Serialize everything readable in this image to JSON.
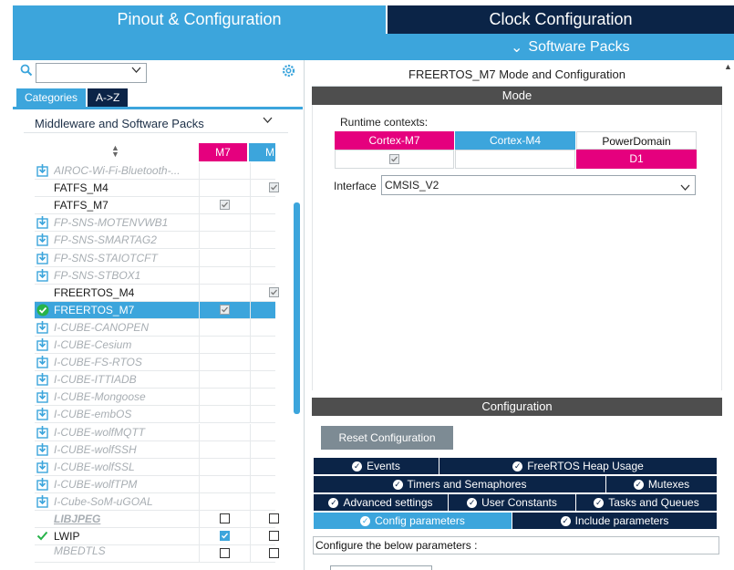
{
  "tabs": {
    "pinout": "Pinout & Configuration",
    "clock": "Clock Configuration"
  },
  "software_packs": "Software Packs",
  "left": {
    "categories_tab": "Categories",
    "az_tab": "A->Z",
    "group_label": "Middleware and Software Packs",
    "col_m7": "M7",
    "col_m4": "M",
    "rows": [
      {
        "name": "AIROC-Wi-Fi-Bluetooth-...",
        "style": "dis",
        "icon": "download"
      },
      {
        "name": "FATFS_M4",
        "style": "plain",
        "icon": ""
      },
      {
        "name": "FATFS_M7",
        "style": "plain",
        "icon": ""
      },
      {
        "name": "FP-SNS-MOTENVWB1",
        "style": "dis",
        "icon": "download"
      },
      {
        "name": "FP-SNS-SMARTAG2",
        "style": "dis",
        "icon": "download"
      },
      {
        "name": "FP-SNS-STAIOTCFT",
        "style": "dis",
        "icon": "download"
      },
      {
        "name": "FP-SNS-STBOX1",
        "style": "dis",
        "icon": "download"
      },
      {
        "name": "FREERTOS_M4",
        "style": "plain",
        "icon": ""
      },
      {
        "name": "FREERTOS_M7",
        "style": "plain",
        "icon": "check-circle"
      },
      {
        "name": "I-CUBE-CANOPEN",
        "style": "dis",
        "icon": "download"
      },
      {
        "name": "I-CUBE-Cesium",
        "style": "dis",
        "icon": "download"
      },
      {
        "name": "I-CUBE-FS-RTOS",
        "style": "dis",
        "icon": "download"
      },
      {
        "name": "I-CUBE-ITTIADB",
        "style": "dis",
        "icon": "download"
      },
      {
        "name": "I-CUBE-Mongoose",
        "style": "dis",
        "icon": "download"
      },
      {
        "name": "I-CUBE-embOS",
        "style": "dis",
        "icon": "download"
      },
      {
        "name": "I-CUBE-wolfMQTT",
        "style": "dis",
        "icon": "download"
      },
      {
        "name": "I-CUBE-wolfSSH",
        "style": "dis",
        "icon": "download"
      },
      {
        "name": "I-CUBE-wolfSSL",
        "style": "dis",
        "icon": "download"
      },
      {
        "name": "I-CUBE-wolfTPM",
        "style": "dis",
        "icon": "download"
      },
      {
        "name": "I-Cube-SoM-uGOAL",
        "style": "dis",
        "icon": "download"
      },
      {
        "name": "LIBJPEG",
        "style": "dis",
        "icon": ""
      },
      {
        "name": "LWIP",
        "style": "plain",
        "icon": "check"
      },
      {
        "name": "MBEDTLS",
        "style": "dis",
        "icon": ""
      }
    ]
  },
  "right": {
    "title": "FREERTOS_M7 Mode and Configuration",
    "mode_header": "Mode",
    "runtime_label": "Runtime contexts:",
    "ctx_m7": "Cortex-M7",
    "ctx_m4": "Cortex-M4",
    "ctx_pd": "PowerDomain",
    "pd_value": "D1",
    "interface_label": "Interface",
    "interface_value": "CMSIS_V2",
    "config_header": "Configuration",
    "reset_button": "Reset Configuration",
    "param_tabs": {
      "events": "Events",
      "heap": "FreeRTOS Heap Usage",
      "timers": "Timers and Semaphores",
      "mutexes": "Mutexes",
      "advanced": "Advanced settings",
      "user_constants": "User Constants",
      "tasks": "Tasks and Queues",
      "config_params": "Config parameters",
      "include_params": "Include parameters"
    },
    "configure_text": "Configure the below parameters :"
  },
  "colors": {
    "accent": "#3ca5dc",
    "navy": "#0b2447",
    "magenta": "#e5007e",
    "dark": "#4e4e4e"
  }
}
